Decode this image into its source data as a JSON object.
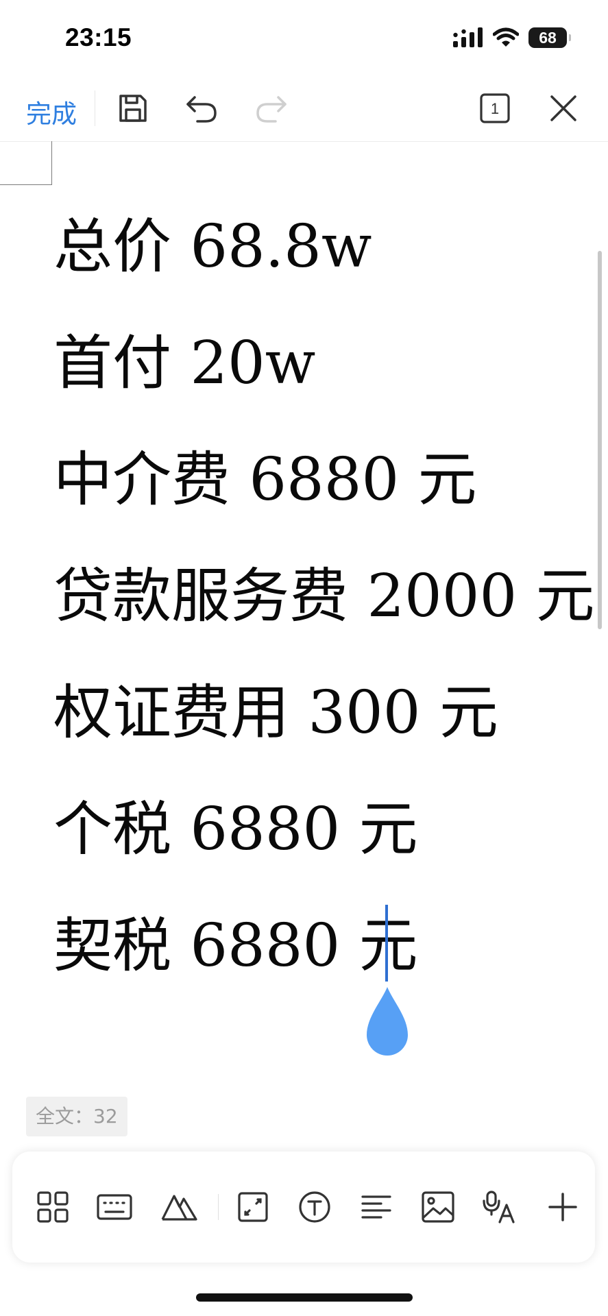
{
  "status_bar": {
    "time": "23:15",
    "battery": "68"
  },
  "toolbar": {
    "done_label": "完成"
  },
  "document": {
    "lines": [
      "总价 68.8w",
      "首付 20w",
      "中介费 6880 元",
      "贷款服务费 2000 元",
      "权证费用 300 元",
      "个税 6880 元",
      "契税 6880 元"
    ]
  },
  "word_count": "全文：32",
  "colors": {
    "accent": "#2f7fe0",
    "cursor": "#2f6fd1",
    "handle": "#57a0f5"
  }
}
